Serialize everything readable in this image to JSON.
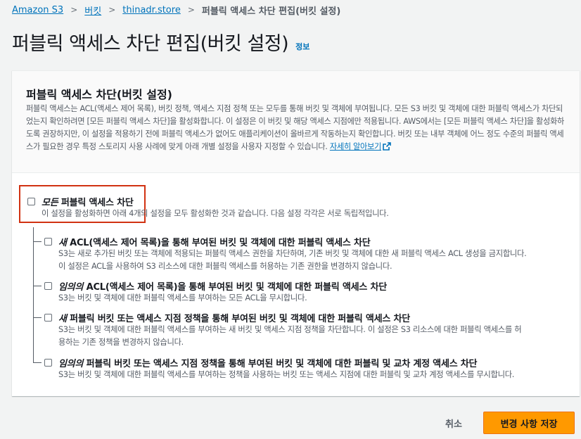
{
  "breadcrumb": {
    "items": [
      "Amazon S3",
      "버킷",
      "thinadr.store"
    ],
    "current": "퍼블릭 액세스 차단 편집(버킷 설정)",
    "separator": ">"
  },
  "page": {
    "title": "퍼블릭 액세스 차단 편집(버킷 설정)",
    "info_label": "정보"
  },
  "panel": {
    "title": "퍼블릭 액세스 차단(버킷 설정)",
    "description": "퍼블릭 액세스는 ACL(액세스 제어 목록), 버킷 정책, 액세스 지점 정책 또는 모두를 통해 버킷 및 객체에 부여됩니다. 모든 S3 버킷 및 객체에 대한 퍼블릭 액세스가 차단되었는지 확인하려면 [모든 퍼블릭 액세스 차단]을 활성화합니다. 이 설정은 이 버킷 및 해당 액세스 지점에만 적용됩니다. AWS에서는 [모든 퍼블릭 액세스 차단]을 활성화하도록 권장하지만, 이 설정을 적용하기 전에 퍼블릭 액세스가 없어도 애플리케이션이 올바르게 작동하는지 확인합니다. 버킷 또는 내부 객체에 어느 정도 수준의 퍼블릭 액세스가 필요한 경우 특정 스토리지 사용 사례에 맞게 아래 개별 설정을 사용자 지정할 수 있습니다.",
    "learn_more": "자세히 알아보기"
  },
  "block_all": {
    "title_em": "모든",
    "title_rest": " 퍼블릭 액세스 차단",
    "description": "이 설정을 활성화하면 아래 4개의 설정을 모두 활성화한 것과 같습니다. 다음 설정 각각은 서로 독립적입니다.",
    "checked": false
  },
  "options": [
    {
      "title_em": "새",
      "title_rest": " ACL(액세스 제어 목록)을 통해 부여된 버킷 및 객체에 대한 퍼블릭 액세스 차단",
      "desc1": "S3는 새로 추가된 버킷 또는 객체에 적용되는 퍼블릭 액세스 권한을 차단하며, 기존 버킷 및 객체에 대한 새 퍼블릭 액세스 ACL 생성을 금지합니다.",
      "desc2": "이 설정은 ACL을 사용하여 S3 리소스에 대한 퍼블릭 액세스를 허용하는 기존 권한을 변경하지 않습니다.",
      "checked": false
    },
    {
      "title_em": "임의의",
      "title_rest": " ACL(액세스 제어 목록)을 통해 부여된 버킷 및 객체에 대한 퍼블릭 액세스 차단",
      "desc1": "S3는 버킷 및 객체에 대한 퍼블릭 액세스를 부여하는 모든 ACL을 무시합니다.",
      "desc2": "",
      "checked": false
    },
    {
      "title_em": "새",
      "title_rest": " 퍼블릭 버킷 또는 액세스 지점 정책을 통해 부여된 버킷 및 객체에 대한 퍼블릭 액세스 차단",
      "desc1": "S3는 버킷 및 객체에 대한 퍼블릭 액세스를 부여하는 새 버킷 및 액세스 지점 정책을 차단합니다. 이 설정은 S3 리소스에 대한 퍼블릭 액세스를 허",
      "desc2": "용하는 기존 정책을 변경하지 않습니다.",
      "checked": false
    },
    {
      "title_em": "임의의",
      "title_rest": " 퍼블릭 버킷 또는 액세스 지점 정책을 통해 부여된 버킷 및 객체에 대한 퍼블릭 및 교차 계정 액세스 차단",
      "desc1": "S3는 버킷 및 객체에 대한 퍼블릭 액세스를 부여하는 정책을 사용하는 버킷 또는 액세스 지점에 대한 퍼블릭 및 교차 계정 액세스를 무시합니다.",
      "desc2": "",
      "checked": false
    }
  ],
  "footer": {
    "cancel_label": "취소",
    "save_label": "변경 사항 저장"
  },
  "colors": {
    "link": "#0073bb",
    "primary_button": "#ff9900",
    "highlight_border": "#d13212",
    "background": "#f2f3f3"
  }
}
